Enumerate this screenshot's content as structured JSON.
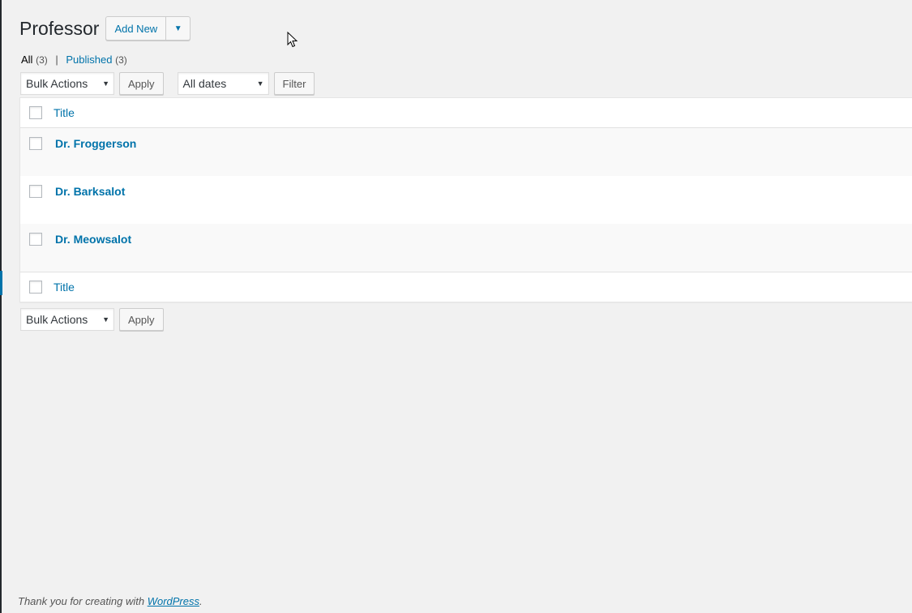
{
  "page": {
    "title": "Professor"
  },
  "header": {
    "add_new_label": "Add New",
    "add_new_arrow": "▼"
  },
  "views": {
    "all_label": "All",
    "all_count": "(3)",
    "separator": "|",
    "published_label": "Published",
    "published_count": "(3)"
  },
  "tablenav_top": {
    "bulk_actions": "Bulk Actions",
    "apply": "Apply",
    "dates": "All dates",
    "filter": "Filter"
  },
  "table": {
    "column_header": "Title",
    "column_footer": "Title",
    "rows": [
      {
        "title": "Dr. Froggerson"
      },
      {
        "title": "Dr. Barksalot"
      },
      {
        "title": "Dr. Meowsalot"
      }
    ]
  },
  "tablenav_bottom": {
    "bulk_actions": "Bulk Actions",
    "apply": "Apply"
  },
  "footer": {
    "text_before": "Thank you for creating with ",
    "link": "WordPress",
    "text_after": "."
  },
  "icons": {
    "caret": "▼"
  }
}
